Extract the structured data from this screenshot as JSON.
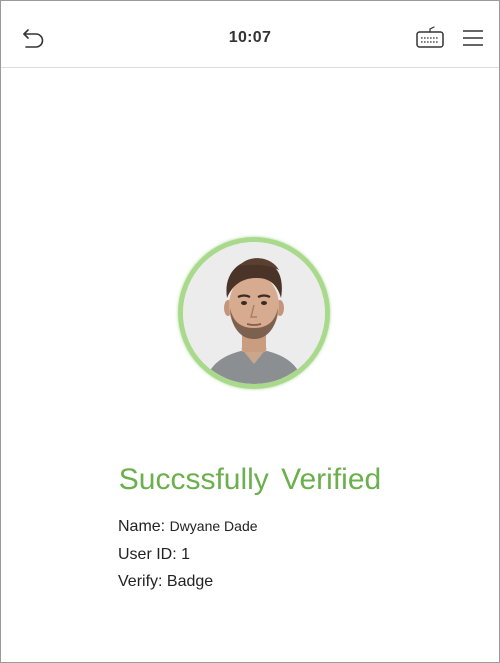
{
  "header": {
    "time": "10:07",
    "back_icon": "back-arrow-icon",
    "keyboard_icon": "keyboard-icon",
    "menu_icon": "menu-icon"
  },
  "verification": {
    "photo_icon": "user-photo",
    "status": "Succssfully  Verified",
    "status_color": "#6ab04c",
    "ring_color": "#a9d98a",
    "name_label": "Name:",
    "name_value": "Dwyane Dade",
    "user_id_label": "User ID:",
    "user_id_value": "1",
    "verify_label": "Verify:",
    "verify_value": "Badge"
  }
}
